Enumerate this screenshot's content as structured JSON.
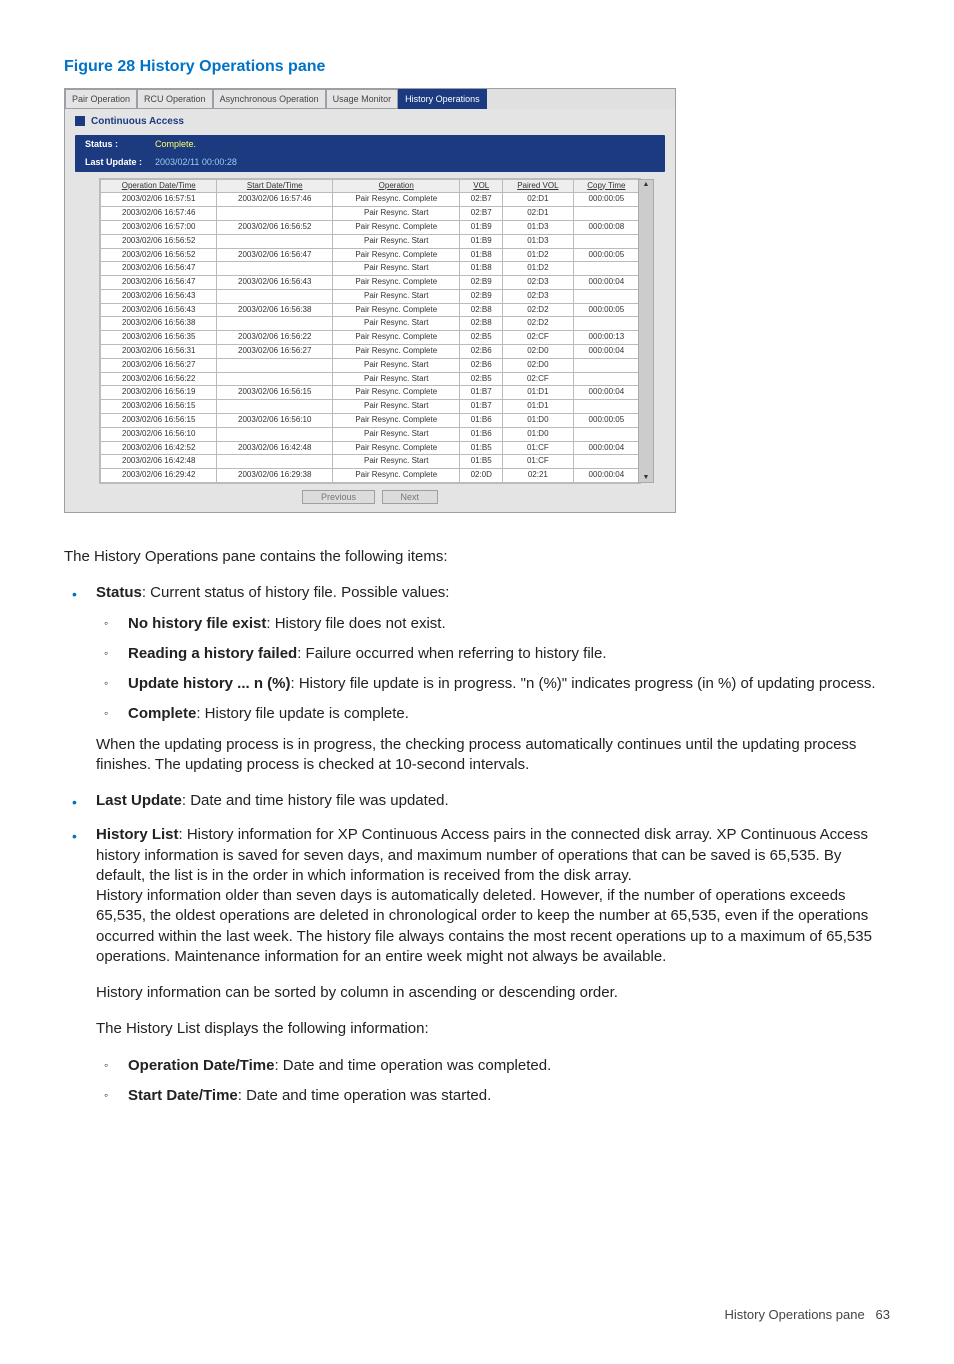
{
  "figure_title": "Figure 28 History Operations pane",
  "tabs": [
    "Pair Operation",
    "RCU Operation",
    "Asynchronous Operation",
    "Usage Monitor",
    "History Operations"
  ],
  "section_title": "Continuous Access",
  "status_rows": [
    {
      "label": "Status :",
      "value": "Complete.",
      "cls": "status-val-a"
    },
    {
      "label": "Last Update :",
      "value": "2003/02/11 00:00:28",
      "cls": "status-val-b"
    }
  ],
  "headers": [
    "Operation Date/Time",
    "Start Date/Time",
    "Operation",
    "VOL",
    "Paired VOL",
    "Copy Time"
  ],
  "rows": [
    [
      "2003/02/06 16:57:51",
      "2003/02/06 16:57:46",
      "Pair Resync. Complete",
      "02:B7",
      "02:D1",
      "000:00:05"
    ],
    [
      "2003/02/06 16:57:46",
      "",
      "Pair Resync. Start",
      "02:B7",
      "02:D1",
      ""
    ],
    [
      "2003/02/06 16:57:00",
      "2003/02/06 16:56:52",
      "Pair Resync. Complete",
      "01:B9",
      "01:D3",
      "000:00:08"
    ],
    [
      "2003/02/06 16:56:52",
      "",
      "Pair Resync. Start",
      "01:B9",
      "01:D3",
      ""
    ],
    [
      "2003/02/06 16:56:52",
      "2003/02/06 16:56:47",
      "Pair Resync. Complete",
      "01:B8",
      "01:D2",
      "000:00:05"
    ],
    [
      "2003/02/06 16:56:47",
      "",
      "Pair Resync. Start",
      "01:B8",
      "01:D2",
      ""
    ],
    [
      "2003/02/06 16:56:47",
      "2003/02/06 16:56:43",
      "Pair Resync. Complete",
      "02:B9",
      "02:D3",
      "000:00:04"
    ],
    [
      "2003/02/06 16:56:43",
      "",
      "Pair Resync. Start",
      "02:B9",
      "02:D3",
      ""
    ],
    [
      "2003/02/06 16:56:43",
      "2003/02/06 16:56:38",
      "Pair Resync. Complete",
      "02:B8",
      "02:D2",
      "000:00:05"
    ],
    [
      "2003/02/06 16:56:38",
      "",
      "Pair Resync. Start",
      "02:B8",
      "02:D2",
      ""
    ],
    [
      "2003/02/06 16:56:35",
      "2003/02/06 16:56:22",
      "Pair Resync. Complete",
      "02:B5",
      "02:CF",
      "000:00:13"
    ],
    [
      "2003/02/06 16:56:31",
      "2003/02/06 16:56:27",
      "Pair Resync. Complete",
      "02:B6",
      "02:D0",
      "000:00:04"
    ],
    [
      "2003/02/06 16:56:27",
      "",
      "Pair Resync. Start",
      "02:B6",
      "02:D0",
      ""
    ],
    [
      "2003/02/06 16:56:22",
      "",
      "Pair Resync. Start",
      "02:B5",
      "02:CF",
      ""
    ],
    [
      "2003/02/06 16:56:19",
      "2003/02/06 16:56:15",
      "Pair Resync. Complete",
      "01:B7",
      "01:D1",
      "000:00:04"
    ],
    [
      "2003/02/06 16:56:15",
      "",
      "Pair Resync. Start",
      "01:B7",
      "01:D1",
      ""
    ],
    [
      "2003/02/06 16:56:15",
      "2003/02/06 16:56:10",
      "Pair Resync. Complete",
      "01:B6",
      "01:D0",
      "000:00:05"
    ],
    [
      "2003/02/06 16:56:10",
      "",
      "Pair Resync. Start",
      "01:B6",
      "01:D0",
      ""
    ],
    [
      "2003/02/06 16:42:52",
      "2003/02/06 16:42:48",
      "Pair Resync. Complete",
      "01:B5",
      "01:CF",
      "000:00:04"
    ],
    [
      "2003/02/06 16:42:48",
      "",
      "Pair Resync. Start",
      "01:B5",
      "01:CF",
      ""
    ],
    [
      "2003/02/06 16:29:42",
      "2003/02/06 16:29:38",
      "Pair Resync. Complete",
      "02:0D",
      "02:21",
      "000:00:04"
    ]
  ],
  "buttons": {
    "prev": "Previous",
    "next": "Next"
  },
  "body": {
    "intro": "The History Operations pane contains the following items:",
    "status_head": "Status",
    "status_tail": ": Current status of history file. Possible values:",
    "no_hist_b": "No history file exist",
    "no_hist_t": ": History file does not exist.",
    "read_fail_b": "Reading a history failed",
    "read_fail_t": ": Failure occurred when referring to history file.",
    "upd_b": "Update history ... n (%)",
    "upd_t": ": History file update is in progress. \"n (%)\" indicates progress (in %) of updating process.",
    "complete_b": "Complete",
    "complete_t": ": History file update is complete.",
    "status_note": "When the updating process is in progress, the checking process automatically continues until the updating process finishes. The updating process is checked at 10-second intervals.",
    "last_update_b": "Last Update",
    "last_update_t": ": Date and time history file was updated.",
    "histlist_b": "History List",
    "histlist_t": ": History information for XP Continuous Access pairs in the connected disk array. XP Continuous Access history information is saved for seven days, and maximum number of operations that can be saved is 65,535. By default, the list is in the order in which information is received from the disk array.",
    "histlist_p2": "History information older than seven days is automatically deleted. However, if the number of operations exceeds 65,535, the oldest operations are deleted in chronological order to keep the number at 65,535, even if the operations occurred within the last week. The history file always contains the most recent operations up to a maximum of 65,535 operations. Maintenance information for an entire week might not always be available.",
    "histlist_p3": "History information can be sorted by column in ascending or descending order.",
    "histlist_p4": "The History List displays the following information:",
    "opdate_b": "Operation Date/Time",
    "opdate_t": ": Date and time operation was completed.",
    "startdate_b": "Start Date/Time",
    "startdate_t": ": Date and time operation was started."
  },
  "footer": {
    "label": "History Operations pane",
    "page": "63"
  }
}
